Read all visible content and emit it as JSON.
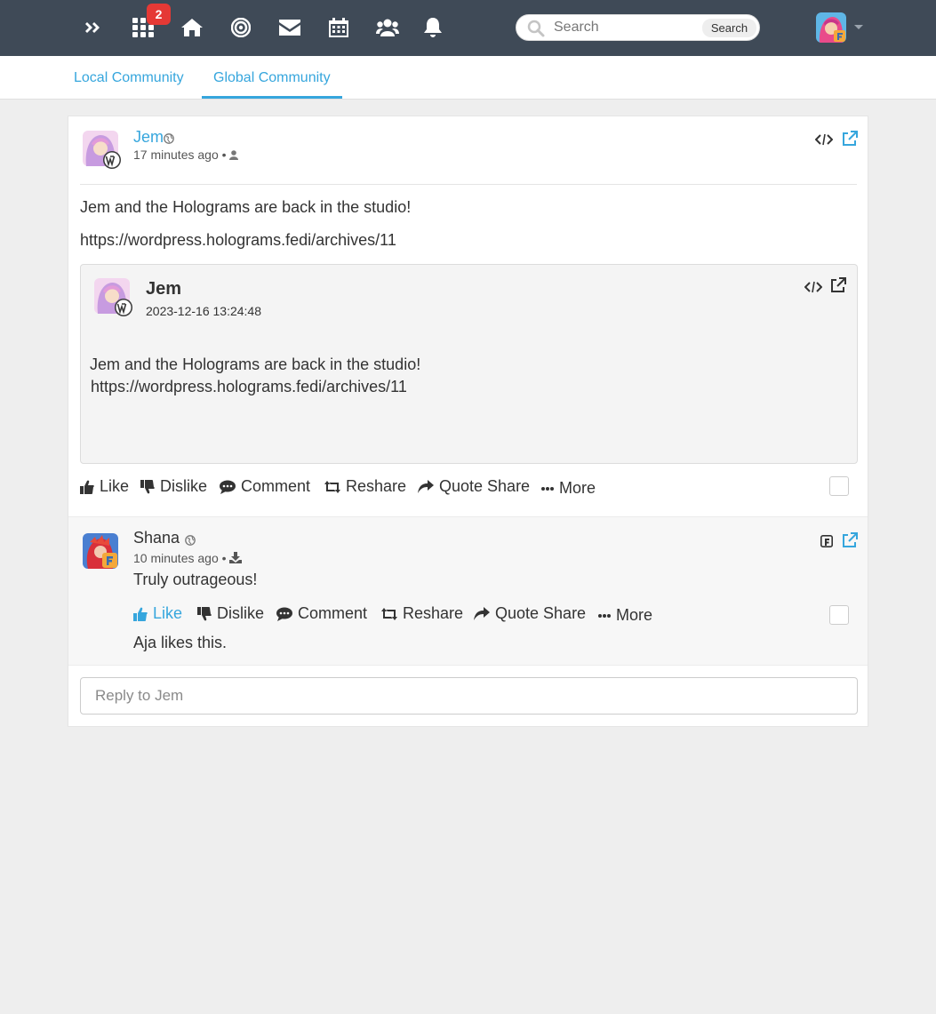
{
  "nav": {
    "notifications_badge": "2",
    "search": {
      "placeholder": "Search",
      "button_label": "Search"
    }
  },
  "tabs": [
    {
      "label": "Local Community",
      "active": false
    },
    {
      "label": "Global Community",
      "active": true
    }
  ],
  "post": {
    "author": "Jem",
    "time": "17 minutes ago",
    "separator": "•",
    "text": "Jem and the Holograms are back in the studio!",
    "link": "https://wordpress.holograms.fedi/archives/11",
    "quote": {
      "author": "Jem",
      "date": "2023-12-16 13:24:48",
      "text": "Jem and the Holograms are back in the studio!",
      "link": "https://wordpress.holograms.fedi/archives/11"
    },
    "actions": {
      "like": "Like",
      "dislike": "Dislike",
      "comment": "Comment",
      "reshare": "Reshare",
      "quote_share": "Quote Share",
      "more": "More"
    }
  },
  "comment": {
    "author": "Shana",
    "time": "10 minutes ago",
    "separator": "•",
    "text": "Truly outrageous!",
    "likes_text": "Aja likes this.",
    "actions": {
      "like": "Like",
      "dislike": "Dislike",
      "comment": "Comment",
      "reshare": "Reshare",
      "quote_share": "Quote Share",
      "more": "More"
    }
  },
  "reply": {
    "placeholder": "Reply to Jem"
  },
  "colors": {
    "nav_bg": "#3f4a57",
    "accent": "#36a6dd",
    "badge": "#e53935"
  }
}
